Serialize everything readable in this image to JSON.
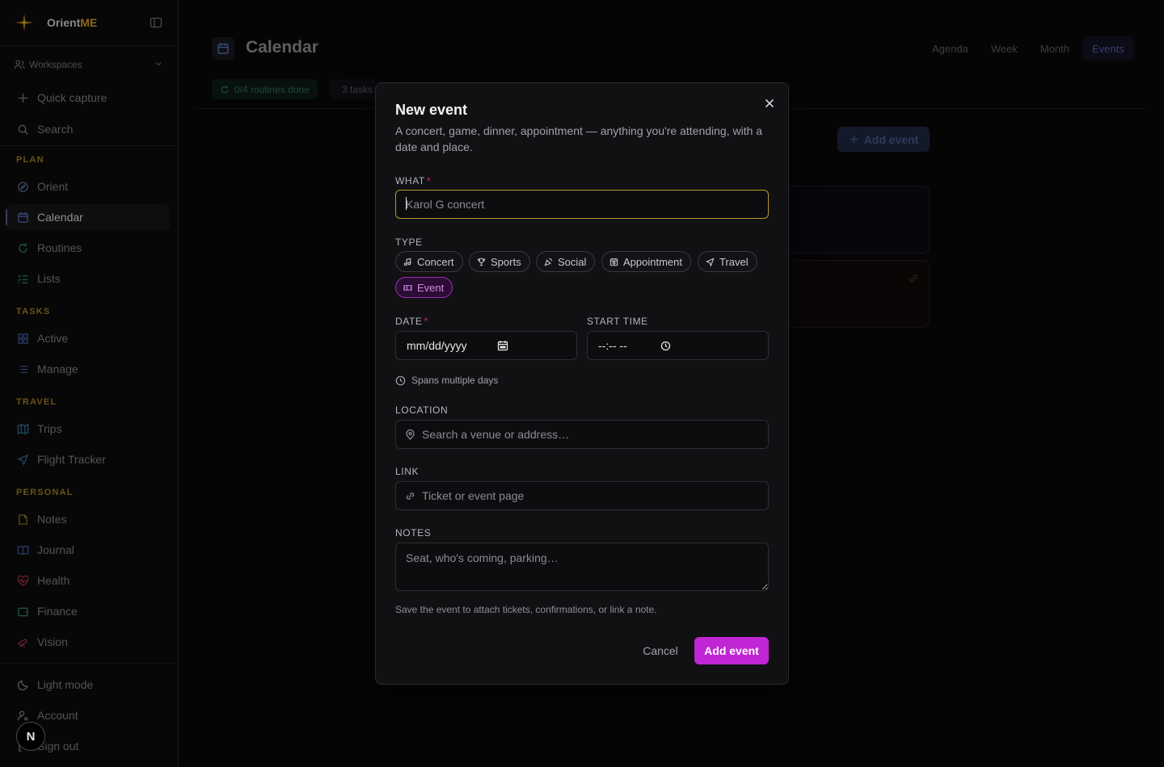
{
  "brand": {
    "name_prefix": "Orient",
    "name_accent": "ME"
  },
  "sidebar": {
    "workspaces": "Workspaces",
    "quick_capture": "Quick capture",
    "search": "Search",
    "sections": {
      "plan": "PLAN",
      "tasks": "TASKS",
      "travel": "TRAVEL",
      "personal": "PERSONAL"
    },
    "plan_items": [
      "Orient",
      "Calendar",
      "Routines",
      "Lists"
    ],
    "tasks_items": [
      "Active",
      "Manage"
    ],
    "travel_items": [
      "Trips",
      "Flight Tracker"
    ],
    "personal_items": [
      "Notes",
      "Journal",
      "Health",
      "Finance",
      "Vision"
    ],
    "footer_items": [
      "Light mode",
      "Account",
      "Sign out"
    ],
    "active_item": "Calendar",
    "avatar_letter": "N"
  },
  "header": {
    "title": "Calendar",
    "view_tabs": [
      "Agenda",
      "Week",
      "Month",
      "Events"
    ],
    "active_tab": "Events"
  },
  "status_chips": {
    "routines": "0/4 routines done",
    "tasks": "3 tasks"
  },
  "events_page": {
    "add_event_label": "Add event"
  },
  "modal": {
    "title": "New event",
    "description": "A concert, game, dinner, appointment — anything you're attending, with a date and place.",
    "what_label": "WHAT",
    "what_placeholder": "Karol G concert",
    "what_value": "",
    "type_label": "TYPE",
    "types": [
      "Concert",
      "Sports",
      "Social",
      "Appointment",
      "Travel",
      "Event"
    ],
    "selected_type": "Event",
    "date_label": "DATE",
    "date_placeholder": "mm/dd/yyyy",
    "start_time_label": "START TIME",
    "time_placeholder": "--:-- --",
    "spans_multiple_days": "Spans multiple days",
    "location_label": "LOCATION",
    "location_placeholder": "Search a venue or address…",
    "link_label": "LINK",
    "link_placeholder": "Ticket or event page",
    "notes_label": "NOTES",
    "notes_placeholder": "Seat, who's coming, parking…",
    "helper_text": "Save the event to attach tickets, confirmations, or link a note.",
    "cancel_label": "Cancel",
    "submit_label": "Add event"
  },
  "colors": {
    "accent_gold": "#b8962a",
    "accent_magenta": "#c026d3",
    "required": "#e11d74",
    "modal_bg": "#111113",
    "page_bg": "#050505"
  }
}
